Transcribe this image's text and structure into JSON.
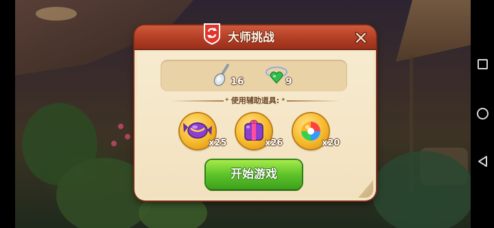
{
  "dialog": {
    "title": "大师挑战",
    "stats": [
      {
        "icon": "spoon-icon",
        "count": "16"
      },
      {
        "icon": "heart-ring-icon",
        "count": "9"
      }
    ],
    "boosters_label": "使用辅助道具:",
    "boosters": [
      {
        "icon": "purple-candy-booster-icon",
        "quantity": "x25"
      },
      {
        "icon": "wrapped-candy-booster-icon",
        "quantity": "x26"
      },
      {
        "icon": "rainbow-ball-booster-icon",
        "quantity": "x20"
      }
    ],
    "start_button_label": "开始游戏"
  },
  "colors": {
    "header_red": "#b23e25",
    "panel_cream": "#f3e4c4",
    "start_green": "#5ec42a",
    "booster_gold": "#f5b92a"
  }
}
